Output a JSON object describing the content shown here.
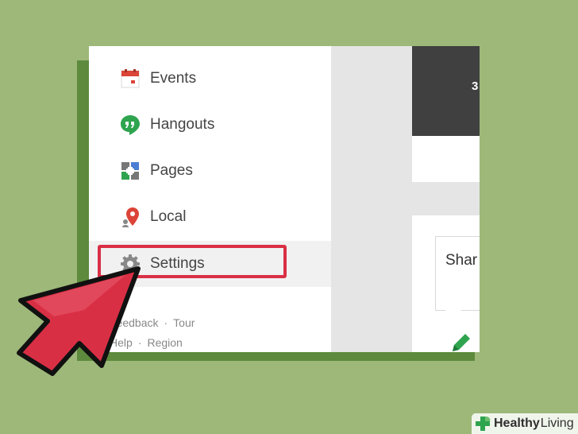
{
  "nav": {
    "items": [
      {
        "label": "Events",
        "icon": "calendar-icon"
      },
      {
        "label": "Hangouts",
        "icon": "hangouts-icon"
      },
      {
        "label": "Pages",
        "icon": "pages-icon"
      },
      {
        "label": "Local",
        "icon": "map-pin-icon"
      },
      {
        "label": "Settings",
        "icon": "gear-icon"
      }
    ]
  },
  "footer": {
    "feedback": "Feedback",
    "separator": "·",
    "tour": "Tour",
    "help": "Help",
    "region": "Region"
  },
  "main": {
    "header_text": "3",
    "share_text": "Shar"
  },
  "watermark": {
    "brand_bold": "Healthy",
    "brand_regular": "Living"
  },
  "colors": {
    "background": "#9db879",
    "frame": "#5d8a3c",
    "highlight": "#d92f45",
    "arrow": "#d92f45",
    "hangouts_green": "#2fa44f",
    "local_red": "#db4437",
    "calendar_red": "#db4437"
  }
}
